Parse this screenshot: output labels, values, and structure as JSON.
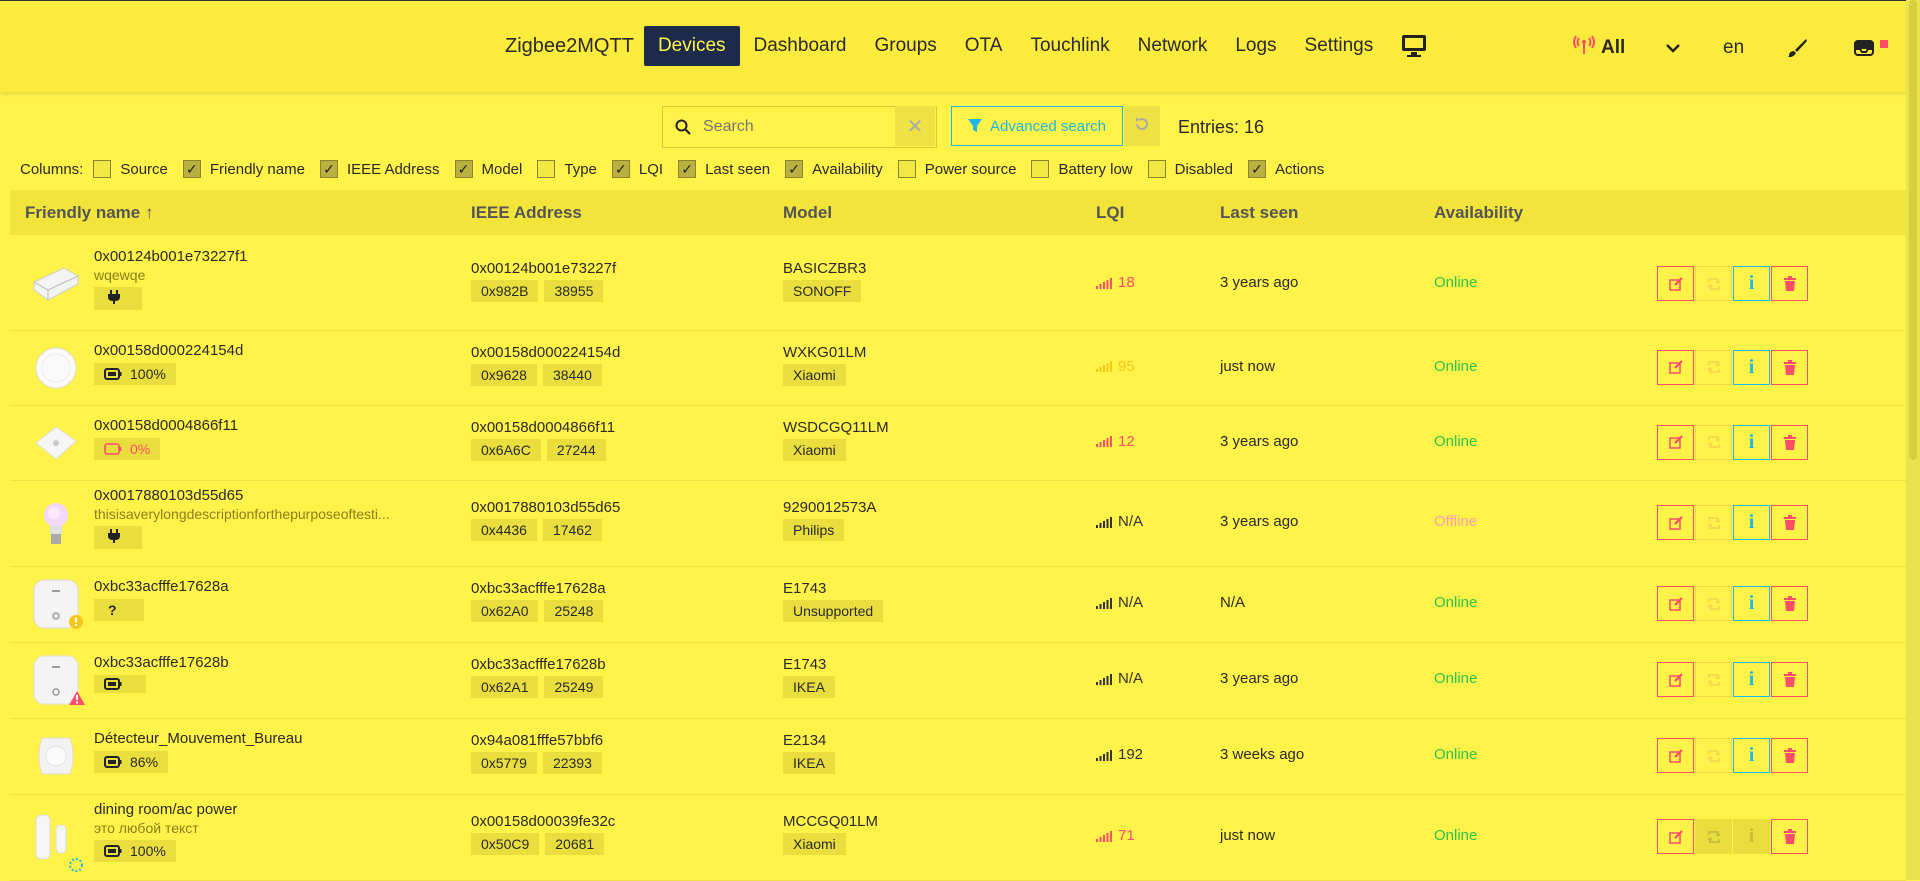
{
  "nav": {
    "brand": "Zigbee2MQTT",
    "items": [
      "Devices",
      "Dashboard",
      "Groups",
      "OTA",
      "Touchlink",
      "Network",
      "Logs",
      "Settings"
    ],
    "active": "Devices",
    "filter_label": "All",
    "language": "en"
  },
  "toolbar": {
    "search_placeholder": "Search",
    "advanced_search_label": "Advanced search",
    "entries_label": "Entries: 16"
  },
  "columns": {
    "label": "Columns:",
    "options": [
      {
        "label": "Source",
        "checked": false
      },
      {
        "label": "Friendly name",
        "checked": true
      },
      {
        "label": "IEEE Address",
        "checked": true
      },
      {
        "label": "Model",
        "checked": true
      },
      {
        "label": "Type",
        "checked": false
      },
      {
        "label": "LQI",
        "checked": true
      },
      {
        "label": "Last seen",
        "checked": true
      },
      {
        "label": "Availability",
        "checked": true
      },
      {
        "label": "Power source",
        "checked": false
      },
      {
        "label": "Battery low",
        "checked": false
      },
      {
        "label": "Disabled",
        "checked": false
      },
      {
        "label": "Actions",
        "checked": true
      }
    ]
  },
  "table": {
    "headers": {
      "friendly_name": "Friendly name ↑",
      "ieee": "IEEE Address",
      "model": "Model",
      "lqi": "LQI",
      "last_seen": "Last seen",
      "availability": "Availability"
    },
    "rows": [
      {
        "name": "0x00124b001e73227f1",
        "desc": "wqewqe",
        "power": "plug",
        "power_text": "",
        "ieee": "0x00124b001e73227f",
        "nwk": "0x982B",
        "nwk_dec": "38955",
        "model": "BASICZBR3",
        "vendor": "SONOFF",
        "lqi": "18",
        "lqi_color": "#ff4d6a",
        "last_seen": "3 years ago",
        "availability": "Online",
        "img": "plug",
        "badge": "",
        "actions_disabled": false
      },
      {
        "name": "0x00158d000224154d",
        "desc": "",
        "power": "battery",
        "power_text": "100%",
        "ieee": "0x00158d000224154d",
        "nwk": "0x9628",
        "nwk_dec": "38440",
        "model": "WXKG01LM",
        "vendor": "Xiaomi",
        "lqi": "95",
        "lqi_color": "#f5c81a",
        "last_seen": "just now",
        "availability": "Online",
        "img": "button",
        "badge": "",
        "actions_disabled": false
      },
      {
        "name": "0x00158d0004866f11",
        "desc": "",
        "power": "battery-low",
        "power_text": "0%",
        "ieee": "0x00158d0004866f11",
        "nwk": "0x6A6C",
        "nwk_dec": "27244",
        "model": "WSDCGQ11LM",
        "vendor": "Xiaomi",
        "lqi": "12",
        "lqi_color": "#ff4d6a",
        "last_seen": "3 years ago",
        "availability": "Online",
        "img": "sensor",
        "badge": "",
        "actions_disabled": false
      },
      {
        "name": "0x0017880103d55d65",
        "desc": "thisisaverylongdescriptionforthepurposeoftesti...",
        "power": "plug",
        "power_text": "",
        "ieee": "0x0017880103d55d65",
        "nwk": "0x4436",
        "nwk_dec": "17462",
        "model": "9290012573A",
        "vendor": "Philips",
        "lqi": "N/A",
        "lqi_color": "#333",
        "last_seen": "3 years ago",
        "availability": "Offline",
        "img": "bulb",
        "badge": "",
        "actions_disabled": false
      },
      {
        "name": "0xbc33acfffe17628a",
        "desc": "",
        "power": "unknown",
        "power_text": "?",
        "ieee": "0xbc33acfffe17628a",
        "nwk": "0x62A0",
        "nwk_dec": "25248",
        "model": "E1743",
        "vendor": "Unsupported",
        "lqi": "N/A",
        "lqi_color": "#333",
        "last_seen": "N/A",
        "availability": "Online",
        "img": "remote",
        "badge": "warn-yellow",
        "actions_disabled": false
      },
      {
        "name": "0xbc33acfffe17628b",
        "desc": "",
        "power": "battery",
        "power_text": "",
        "ieee": "0xbc33acfffe17628b",
        "nwk": "0x62A1",
        "nwk_dec": "25249",
        "model": "E1743",
        "vendor": "IKEA",
        "lqi": "N/A",
        "lqi_color": "#333",
        "last_seen": "3 years ago",
        "availability": "Online",
        "img": "remote",
        "badge": "warn-red",
        "actions_disabled": false
      },
      {
        "name": "Détecteur_Mouvement_Bureau",
        "desc": "",
        "power": "battery",
        "power_text": "86%",
        "ieee": "0x94a081fffe57bbf6",
        "nwk": "0x5779",
        "nwk_dec": "22393",
        "model": "E2134",
        "vendor": "IKEA",
        "lqi": "192",
        "lqi_color": "#333",
        "last_seen": "3 weeks ago",
        "availability": "Online",
        "img": "motion",
        "badge": "",
        "actions_disabled": false
      },
      {
        "name": "dining room/ac power",
        "desc": "это любой текст",
        "power": "battery",
        "power_text": "100%",
        "ieee": "0x00158d00039fe32c",
        "nwk": "0x50C9",
        "nwk_dec": "20681",
        "model": "MCCGQ01LM",
        "vendor": "Xiaomi",
        "lqi": "71",
        "lqi_color": "#ff4d6a",
        "last_seen": "just now",
        "availability": "Online",
        "img": "contact",
        "badge": "spinner",
        "actions_disabled": true
      }
    ]
  },
  "colors": {
    "background": "#fff34a",
    "nav_active": "#1c2b4a",
    "online": "#2ec24a",
    "offline": "#ff9eb0",
    "danger": "#ff4d6a",
    "info": "#1fb7e4"
  }
}
